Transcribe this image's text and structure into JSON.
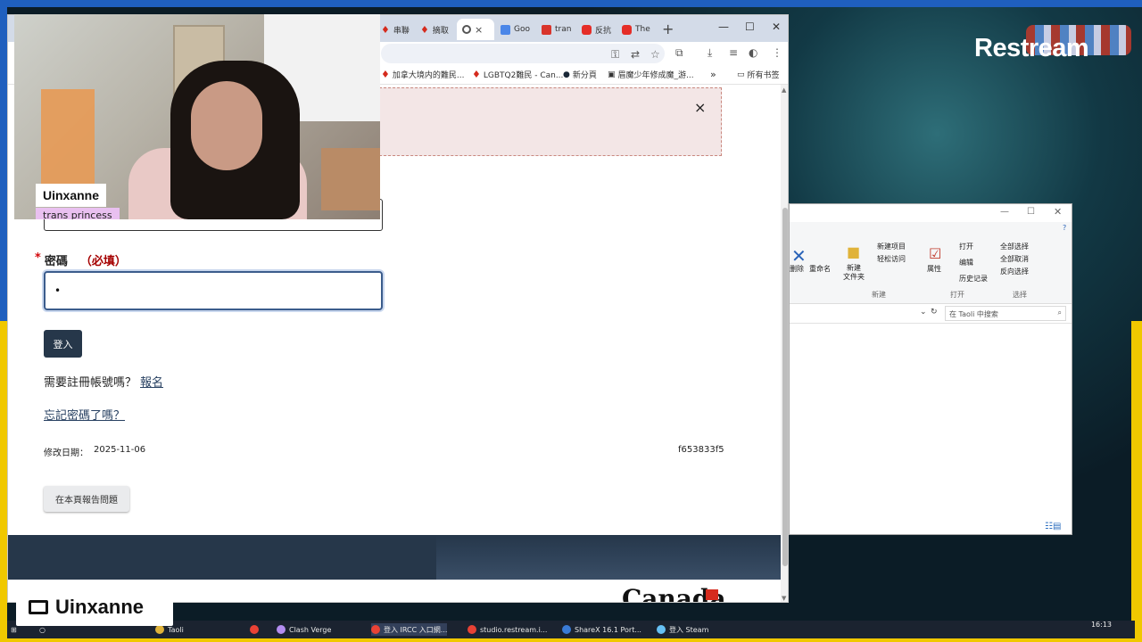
{
  "stream": {
    "brand": "Restream"
  },
  "browser": {
    "tabs": [
      {
        "label": "串聯",
        "icon": "maple-leaf-icon"
      },
      {
        "label": "摘取",
        "icon": "maple-leaf-icon"
      },
      {
        "label": "",
        "icon": "globe-icon",
        "close": "×"
      },
      {
        "label": "Goo",
        "icon": "translate-icon"
      },
      {
        "label": "tran",
        "icon": "bookmark-icon"
      },
      {
        "label": "反抗",
        "icon": "youtube-icon"
      },
      {
        "label": "The",
        "icon": "youtube-icon"
      }
    ],
    "new_tab": "+",
    "window_controls": {
      "minimize": "—",
      "maximize": "☐",
      "close": "✕"
    },
    "bookmarks": [
      {
        "label": "加拿大境内的難民..."
      },
      {
        "label": "LGBTQ2難民 - Can..."
      },
      {
        "label": "新分頁"
      },
      {
        "label": "眉魔少年修成魔_游..."
      }
    ],
    "bookmarks_more": "»",
    "all_bookmarks": "所有书签"
  },
  "page": {
    "alert_close": "×",
    "password_label": "密碼",
    "required_star": "*",
    "required_note": "（必填）",
    "password_value": "•",
    "login_button": "登入",
    "register_prompt": "需要註冊帳號嗎？",
    "register_link": "報名",
    "forgot_link": "忘記密碼了嗎？",
    "modified_label": "修改日期：",
    "modified_date": "2025-11-06",
    "version": "f653833f5",
    "report_button": "在本頁報告問題",
    "wordmark": "Canada"
  },
  "webcam": {
    "name": "Uinxanne",
    "subtitle": "trans princess"
  },
  "explorer": {
    "ribbon": {
      "delete": "删除",
      "rename": "重命名",
      "new_folder": "新建\n文件夹",
      "new_item": "新建项目",
      "easy_access": "轻松访问",
      "properties": "属性",
      "open": "打开",
      "edit": "编辑",
      "history": "历史记录",
      "select_all": "全部选择",
      "select_none": "全部取消",
      "invert": "反向选择",
      "group_new": "新建",
      "group_open": "打开",
      "group_select": "选择"
    },
    "search_placeholder": "在 Taoli 中搜索"
  },
  "brand_card": {
    "name": "Uinxanne"
  },
  "taskbar": {
    "items": [
      {
        "label": "Taoli"
      },
      {
        "label": ""
      },
      {
        "label": "Clash Verge"
      },
      {
        "label": "登入 IRCC 入口網..."
      },
      {
        "label": "studio.restream.i..."
      },
      {
        "label": "ShareX 16.1 Port..."
      },
      {
        "label": "登入 Steam"
      }
    ],
    "time": "16:13"
  },
  "colors": {
    "gc_navy": "#26374a",
    "link": "#284162",
    "required_red": "#d3080c",
    "stream_blue": "#1f5fbe",
    "stream_yellow": "#f0c800"
  }
}
